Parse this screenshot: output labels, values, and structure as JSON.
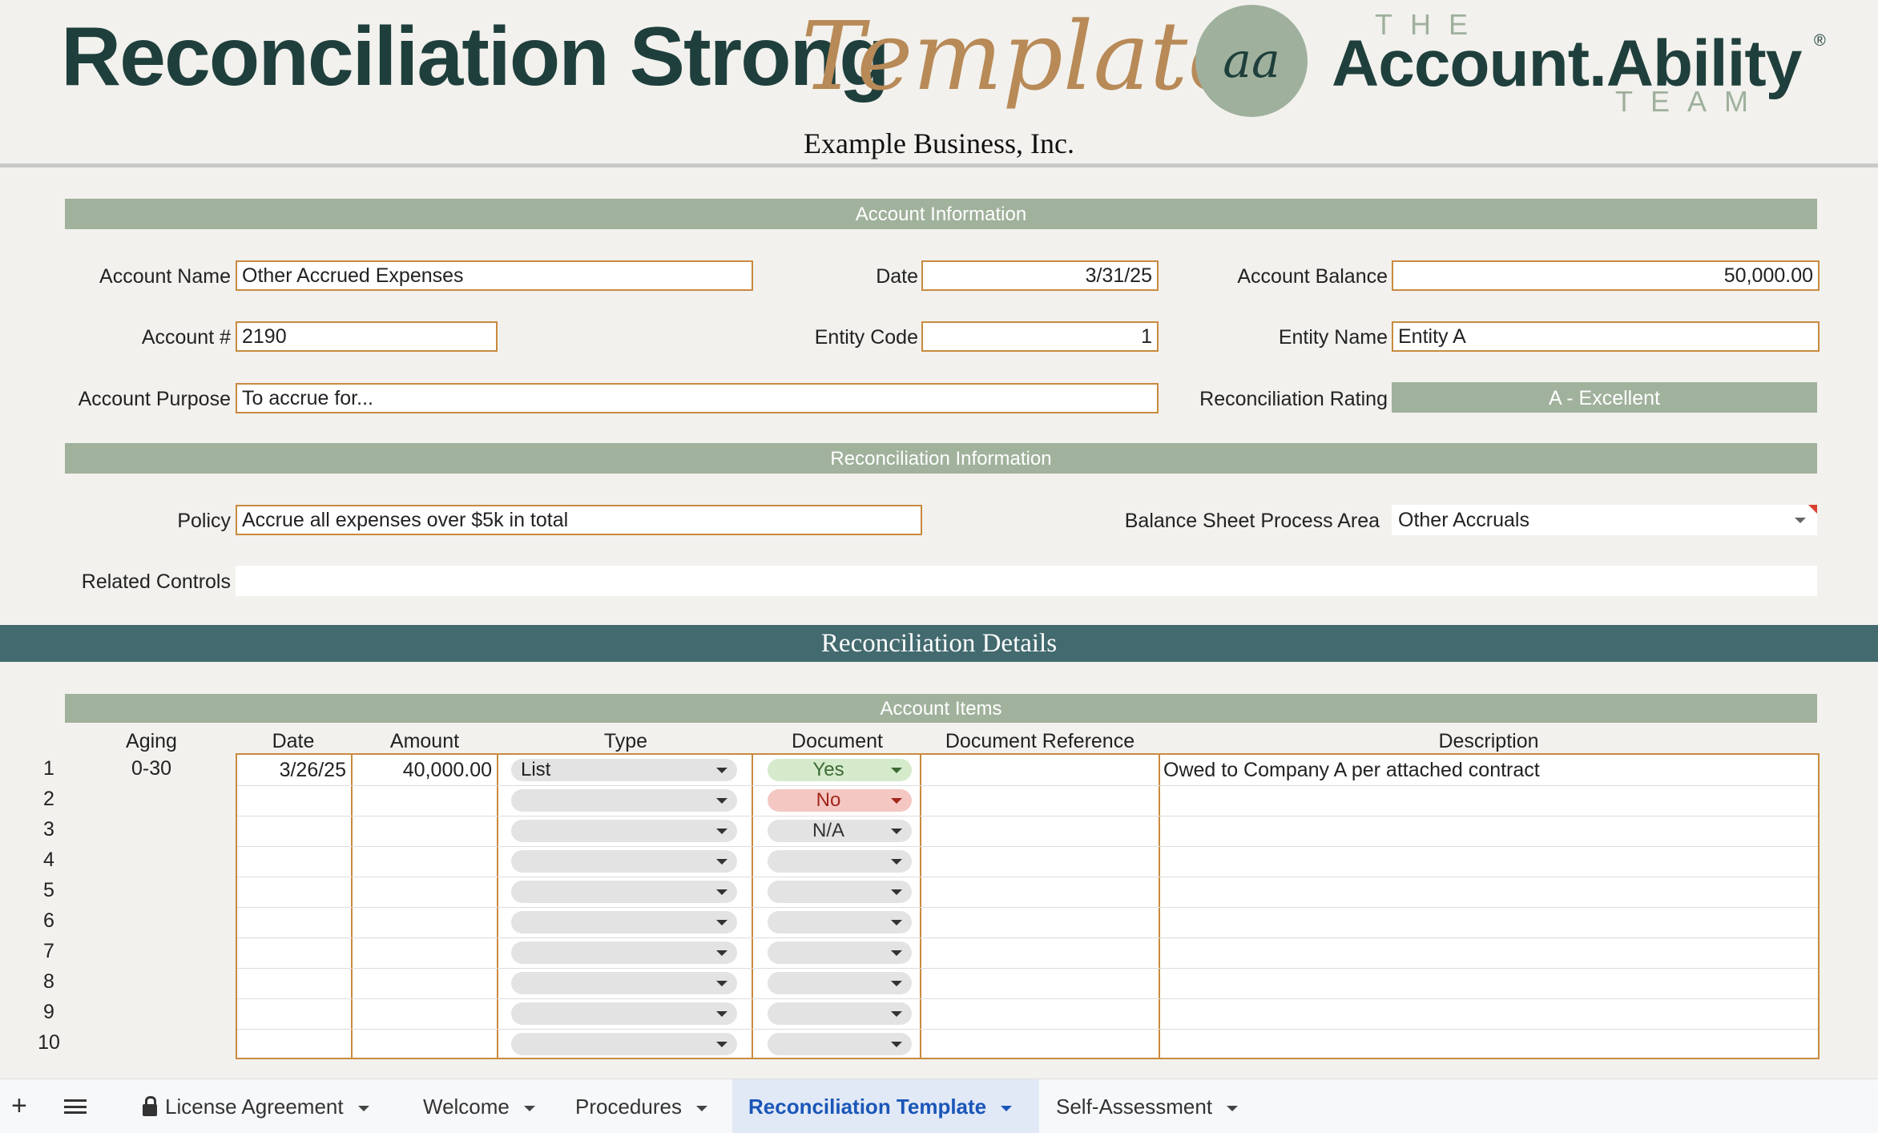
{
  "header": {
    "title_main": "Reconciliation Strong",
    "title_script": "Template",
    "logo_mark": "aa",
    "brand_the": "THE",
    "brand_name": "Account.Ability",
    "brand_reg": "®",
    "brand_team": "TEAM",
    "company": "Example Business, Inc."
  },
  "account_info": {
    "section_title": "Account Information",
    "account_name_label": "Account Name",
    "account_name": "Other Accrued Expenses",
    "date_label": "Date",
    "date": "3/31/25",
    "balance_label": "Account Balance",
    "balance": "50,000.00",
    "account_num_label": "Account #",
    "account_num": "2190",
    "entity_code_label": "Entity Code",
    "entity_code": "1",
    "entity_name_label": "Entity Name",
    "entity_name": "Entity A",
    "purpose_label": "Account Purpose",
    "purpose": "To accrue for...",
    "rating_label": "Reconciliation Rating",
    "rating": "A - Excellent"
  },
  "recon_info": {
    "section_title": "Reconciliation Information",
    "policy_label": "Policy",
    "policy": "Accrue all expenses over $5k in total",
    "process_area_label": "Balance Sheet Process Area",
    "process_area": "Other Accruals",
    "related_controls_label": "Related Controls",
    "related_controls": ""
  },
  "details": {
    "title": "Reconciliation Details",
    "items_title": "Account Items",
    "columns": {
      "aging": "Aging",
      "date": "Date",
      "amount": "Amount",
      "type": "Type",
      "document": "Document",
      "doc_ref": "Document Reference",
      "description": "Description"
    },
    "rows": [
      {
        "num": "1",
        "aging": "0-30",
        "date": "3/26/25",
        "amount": "40,000.00",
        "type": "List",
        "document": "Yes",
        "doc_ref": "",
        "description": "Owed to Company A per attached contract"
      },
      {
        "num": "2",
        "aging": "",
        "date": "",
        "amount": "",
        "type": "",
        "document": "No",
        "doc_ref": "",
        "description": ""
      },
      {
        "num": "3",
        "aging": "",
        "date": "",
        "amount": "",
        "type": "",
        "document": "N/A",
        "doc_ref": "",
        "description": ""
      },
      {
        "num": "4",
        "aging": "",
        "date": "",
        "amount": "",
        "type": "",
        "document": "",
        "doc_ref": "",
        "description": ""
      },
      {
        "num": "5",
        "aging": "",
        "date": "",
        "amount": "",
        "type": "",
        "document": "",
        "doc_ref": "",
        "description": ""
      },
      {
        "num": "6",
        "aging": "",
        "date": "",
        "amount": "",
        "type": "",
        "document": "",
        "doc_ref": "",
        "description": ""
      },
      {
        "num": "7",
        "aging": "",
        "date": "",
        "amount": "",
        "type": "",
        "document": "",
        "doc_ref": "",
        "description": ""
      },
      {
        "num": "8",
        "aging": "",
        "date": "",
        "amount": "",
        "type": "",
        "document": "",
        "doc_ref": "",
        "description": ""
      },
      {
        "num": "9",
        "aging": "",
        "date": "",
        "amount": "",
        "type": "",
        "document": "",
        "doc_ref": "",
        "description": ""
      },
      {
        "num": "10",
        "aging": "",
        "date": "",
        "amount": "",
        "type": "",
        "document": "",
        "doc_ref": "",
        "description": ""
      }
    ]
  },
  "tabs": {
    "add_icon": "plus-icon",
    "menu_icon": "menu-icon",
    "items": [
      "License Agreement",
      "Welcome",
      "Procedures",
      "Reconciliation Template",
      "Self-Assessment"
    ],
    "active": "Reconciliation Template"
  },
  "colors": {
    "brand_dark": "#1f3f3c",
    "brand_sage": "#a0b19c",
    "brand_gold": "#b88a57",
    "details_bar": "#436a6e",
    "field_border": "#c98a3e",
    "tab_active": "#1a56b8"
  }
}
